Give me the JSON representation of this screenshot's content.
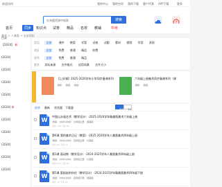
{
  "topbar": {
    "left": "欢迎访问",
    "links": [
      "我的中心",
      "我的空间",
      "我的下载",
      "客户代表",
      "APP下载",
      "更多"
    ]
  },
  "header": {
    "search_placeholder": "在海量资源中搜索",
    "search_button": "搜索",
    "actions": [
      {
        "label": "我的云盘",
        "icon": "cloud-icon",
        "color": "#e8f0fd"
      },
      {
        "label": "帮助",
        "icon": "help-icon",
        "color": "#fde8e8"
      }
    ]
  },
  "nav": {
    "items": [
      "首页",
      "同步",
      "知识点",
      "试卷",
      "精品",
      "名校",
      "教辅",
      "中考"
    ],
    "active_index": 1
  },
  "sidebar": {
    "title": "目录",
    "items": [
      {
        "text": "【2024】",
        "badge": "新"
      },
      {
        "text": "(2024)"
      },
      {
        "text": "(2024)"
      },
      {
        "text": "(2024)"
      },
      {
        "text": "(2024)"
      },
      {
        "text": "(2024)",
        "badge": "新"
      },
      {
        "text": "(2024)"
      },
      {
        "text": "(2024)"
      },
      {
        "text": "(2024)"
      },
      {
        "text": "(2024)"
      },
      {
        "text": "(2024)"
      }
    ]
  },
  "breadcrumb": "美术 > 人美版 > 全部资料",
  "filters": [
    {
      "key": "类型",
      "options": [
        "全部",
        "课件",
        "教案",
        "学案",
        "试卷",
        "试题",
        "素材",
        "视频",
        "学案",
        "其他"
      ],
      "selected": 0
    },
    {
      "key": "地区",
      "options": [
        "全部",
        "免费",
        "普通",
        "精品",
        "收费"
      ],
      "selected": 0
    },
    {
      "key": "排序",
      "options": [
        "全部",
        "免费",
        "普通",
        "精品"
      ],
      "selected": 0
    },
    {
      "key": "更多",
      "options": [
        "资料来源",
        "文件格式",
        "适用场景",
        "文件大小"
      ],
      "selected": -1
    }
  ],
  "featured": [
    {
      "title": "【上好课】2025-2026学年小学同步备课系列",
      "chips": [
        "课件",
        "教案",
        "学案"
      ],
      "color": "#f08a5d"
    },
    {
      "title": "六年级上册美术同步备课系列（课",
      "chips": [
        "课件",
        "教案"
      ],
      "color": "#4caf50"
    }
  ],
  "sortbar": {
    "label": "综合",
    "options": [
      "最新",
      "浏览量",
      "下载量"
    ],
    "toggles": [
      "列表",
      "卡片"
    ]
  },
  "items": [
    {
      "title": "中国山水画艺术（教学设计）-2025-2026学年赣美版美术六年级上册",
      "meta": [
        "教案",
        "2025-2026",
        "六年级上册",
        "赣美版"
      ],
      "stats": "浏览 128  下载 36"
    },
    {
      "title": "第6课 我的美术日记（教案）-2025-2026学年人美版美术四年级上册",
      "meta": [
        "教案",
        "2025-2026",
        "四年级上册",
        "人美版"
      ],
      "stats": "浏览 96  下载 21"
    },
    {
      "title": "第3课 画动物（教学设计）-2024-2025学年人美版美术四年级上册",
      "meta": [
        "教案",
        "2024-2025",
        "四年级上册",
        "人美版"
      ],
      "stats": "浏览 210  下载 54"
    },
    {
      "title": "第5课 瓷娃娃的向往（教学设计）-2024-2025学年赣美版美术四年级下册",
      "meta": [
        "教案",
        "2024-2025",
        "四年级下册",
        "赣美版"
      ],
      "stats": "浏览 75  下载 18"
    }
  ],
  "colors": {
    "accent": "#2f6fdc",
    "bg": "#f3f4f6"
  }
}
